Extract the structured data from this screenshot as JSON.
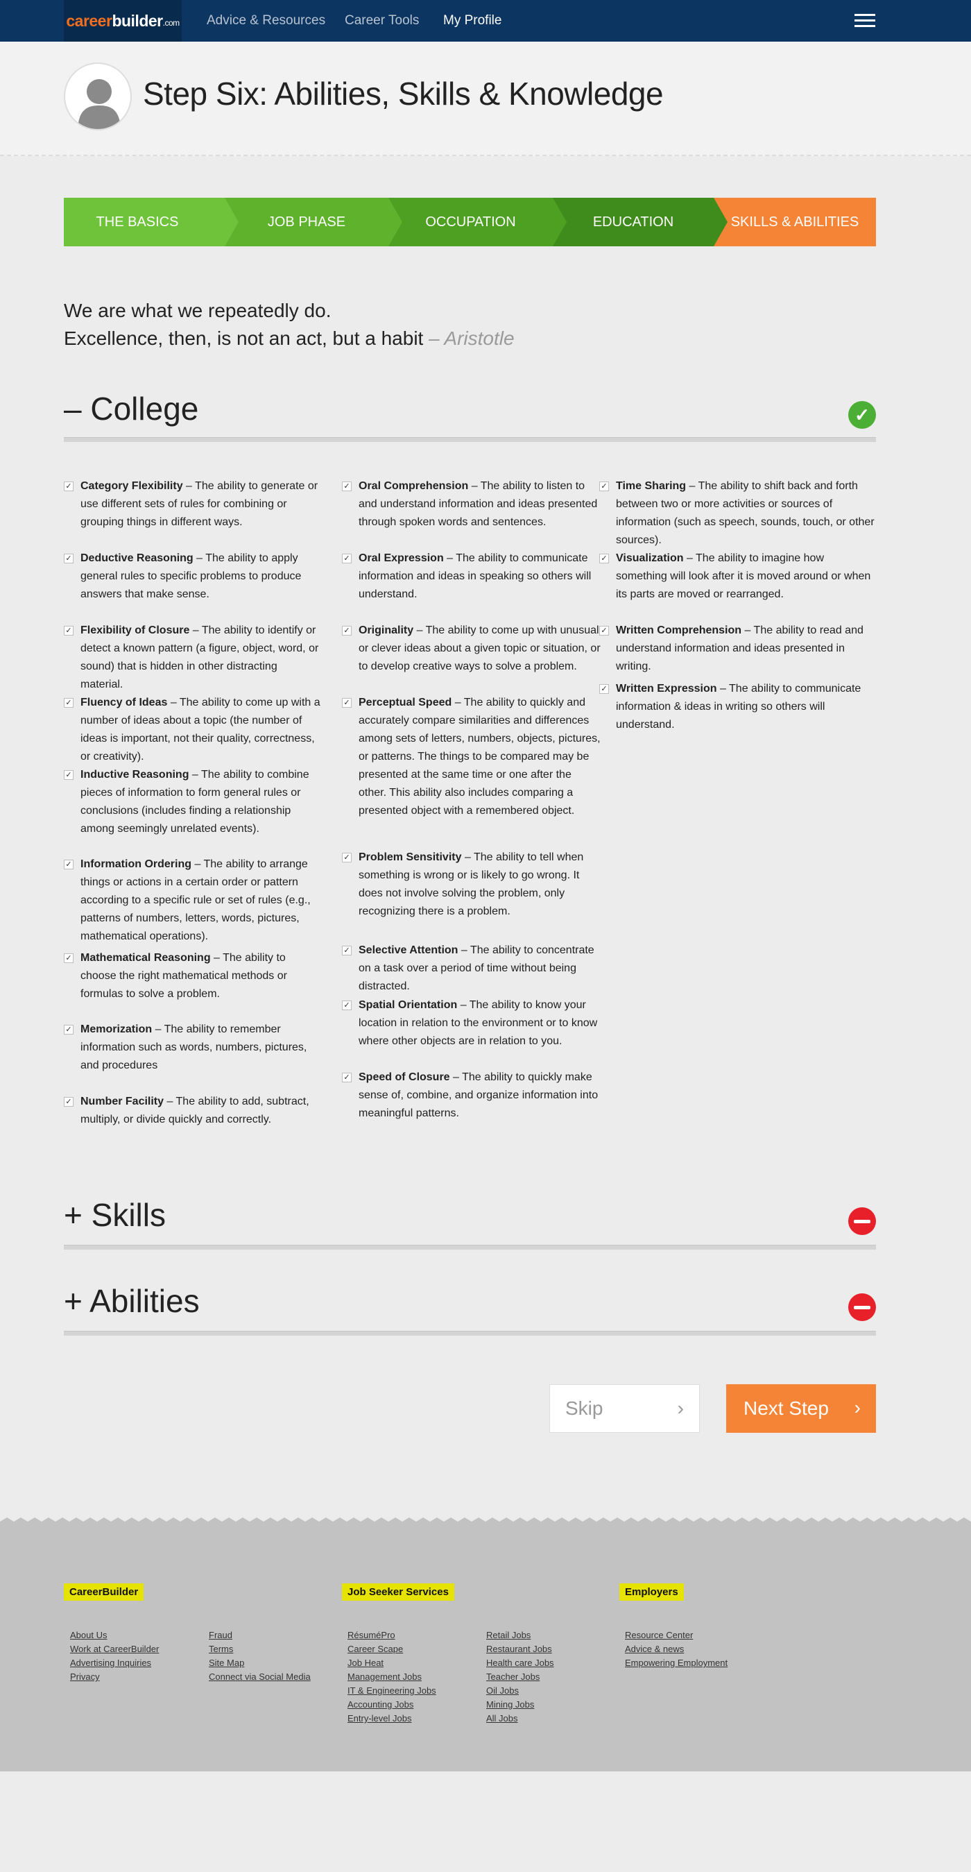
{
  "header": {
    "logo": {
      "part1": "career",
      "part2": "builder",
      "part3": ".com"
    },
    "nav": [
      "Advice & Resources",
      "Career Tools",
      "My Profile"
    ],
    "menu_icon": "hamburger-icon"
  },
  "profile": {
    "avatar_icon": "user-silhouette-icon",
    "title": "Step Six: Abilities, Skills & Knowledge"
  },
  "steps": [
    {
      "label": "THE BASICS",
      "color": "#6fc33b"
    },
    {
      "label": "JOB PHASE",
      "color": "#5fb22c"
    },
    {
      "label": "OCCUPATION",
      "color": "#4ea022"
    },
    {
      "label": "EDUCATION",
      "color": "#3f8c1c"
    },
    {
      "label": "SKILLS & ABILITIES",
      "color": "#f58436"
    }
  ],
  "quote": {
    "line1": "We are what we repeatedly do.",
    "line2": "Excellence, then, is not an act, but a habit",
    "author": "– Aristotle"
  },
  "sections": {
    "college": {
      "title": "– College",
      "status_icon": "checkmark-icon"
    },
    "skills": {
      "title": "+ Skills",
      "status_icon": "minus-circle-icon"
    },
    "abilities": {
      "title": "+ Abilities",
      "status_icon": "minus-circle-icon"
    }
  },
  "columns": [
    [
      {
        "name": "Category Flexibility",
        "desc": " – The ability to generate or use different sets of rules for combining or grouping things in different ways."
      },
      {
        "name": "Deductive Reasoning",
        "desc": " – The ability to apply general rules to specific problems to produce answers that make sense."
      },
      {
        "name": "Flexibility of Closure",
        "desc": " – The ability to identify or detect a known pattern (a figure, object, word, or sound) that is hidden in other distracting material."
      },
      {
        "name": "Fluency of Ideas",
        "desc": " – The ability to come up with a number of ideas about a topic (the number of ideas is important, not their quality, correctness, or creativity)."
      },
      {
        "name": "Inductive Reasoning",
        "desc": " – The ability to combine pieces of information to form general rules or conclusions (includes finding a relationship among seemingly unrelated events)."
      },
      {
        "name": "Information Ordering",
        "desc": " – The ability to arrange things or actions in a certain order or pattern according to a specific rule or set of rules (e.g., patterns of numbers, letters, words, pictures, mathematical operations)."
      },
      {
        "name": "Mathematical Reasoning",
        "desc": " – The ability to choose the right mathematical methods or formulas to solve a problem."
      },
      {
        "name": "Memorization",
        "desc": " – The ability to remember information such as words, numbers, pictures, and procedures"
      },
      {
        "name": "Number Facility",
        "desc": " – The ability to add, subtract, multiply, or divide quickly and correctly."
      }
    ],
    [
      {
        "name": "Oral Comprehension",
        "desc": " – The ability to listen to and understand information and ideas presented through spoken words and sentences."
      },
      {
        "name": "Oral Expression",
        "desc": " – The ability to communicate information and ideas in speaking so others will understand."
      },
      {
        "name": "Originality",
        "desc": " – The ability to come up with unusual or clever ideas about a given topic or situation, or to develop creative ways to solve a problem."
      },
      {
        "name": "Perceptual Speed",
        "desc": " – The ability to quickly and accurately compare similarities and differences among sets of letters, numbers, objects, pictures, or patterns. The things to be compared may be presented at the same time or one after the other. This ability also includes comparing a presented object with a remembered object."
      },
      {
        "name": "Problem Sensitivity",
        "desc": " – The ability to tell when something is wrong or is likely to go wrong. It does not involve solving the problem, only recognizing there is a problem."
      },
      {
        "name": "Selective Attention",
        "desc": " – The ability to concentrate on a task over a period of time without being distracted."
      },
      {
        "name": "Spatial Orientation",
        "desc": " – The ability to know your location in relation to the environment or to know where other objects are in relation to you."
      },
      {
        "name": "Speed of Closure",
        "desc": " – The ability to quickly make sense of, combine, and organize information into meaningful patterns."
      }
    ],
    [
      {
        "name": "Time Sharing",
        "desc": " – The ability to shift back and forth between two or more activities or sources of information (such as speech, sounds, touch, or other sources)."
      },
      {
        "name": "Visualization",
        "desc": " – The ability to imagine how something will look after it is moved around or when its parts are moved or rearranged."
      },
      {
        "name": "Written Comprehension",
        "desc": " – The ability to read and understand information and ideas presented in writing."
      },
      {
        "name": "Written Expression",
        "desc": " – The ability to communicate information & ideas in writing so others will understand."
      }
    ]
  ],
  "buttons": {
    "skip": "Skip",
    "next": "Next Step",
    "chevron": "›"
  },
  "footer": {
    "careerbuilder": {
      "title": "CareerBuilder",
      "col1": [
        "About Us",
        "Work at CareerBuilder",
        "Advertising Inquiries",
        "Privacy"
      ],
      "col2": [
        "Fraud",
        "Terms",
        "Site Map",
        "Connect via Social Media"
      ]
    },
    "jobseeker": {
      "title": "Job Seeker Services",
      "col1": [
        "RésuméPro",
        "Career Scape",
        "Job Heat",
        "Management Jobs",
        "IT & Engineering Jobs",
        "Accounting Jobs",
        "Entry-level Jobs"
      ],
      "col2": [
        "Retail Jobs",
        "Restaurant Jobs",
        "Health care Jobs",
        "Teacher Jobs",
        "Oil Jobs",
        "Mining Jobs",
        "All Jobs"
      ]
    },
    "employers": {
      "title": "Employers",
      "col1": [
        "Resource Center",
        "Advice & news",
        "Empowering Employment"
      ]
    }
  }
}
